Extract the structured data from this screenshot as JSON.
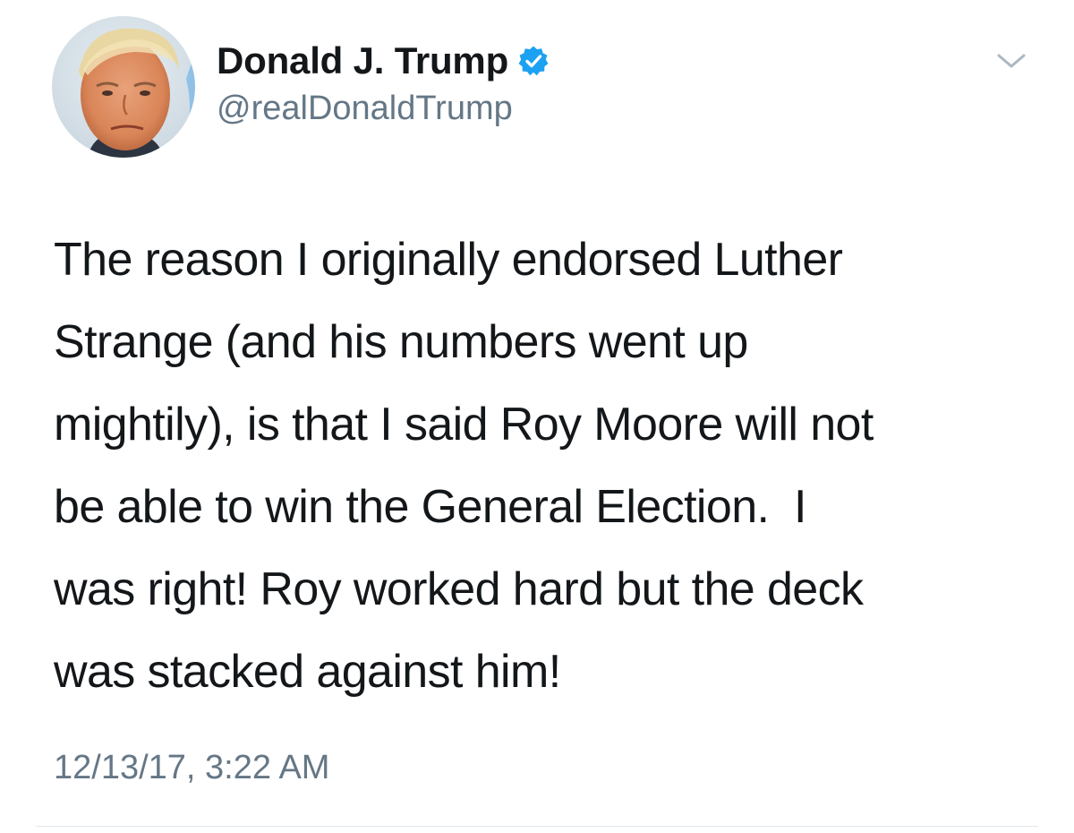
{
  "author": {
    "name": "Donald J. Trump",
    "handle": "@realDonaldTrump",
    "verified": true,
    "verified_color": "#1da1f2"
  },
  "menu": {
    "icon": "chevron-down-icon"
  },
  "tweet": {
    "lines": [
      "The reason I originally endorsed Luther",
      "Strange (and his numbers went up",
      "mightily), is that I said Roy Moore will not",
      "be able to win the General Election.  I",
      "was right! Roy worked hard but the deck",
      "was stacked against him!"
    ],
    "timestamp": "12/13/17, 3:22 AM"
  },
  "colors": {
    "text": "#14171a",
    "secondary": "#657786",
    "divider": "#e1e8ed"
  }
}
